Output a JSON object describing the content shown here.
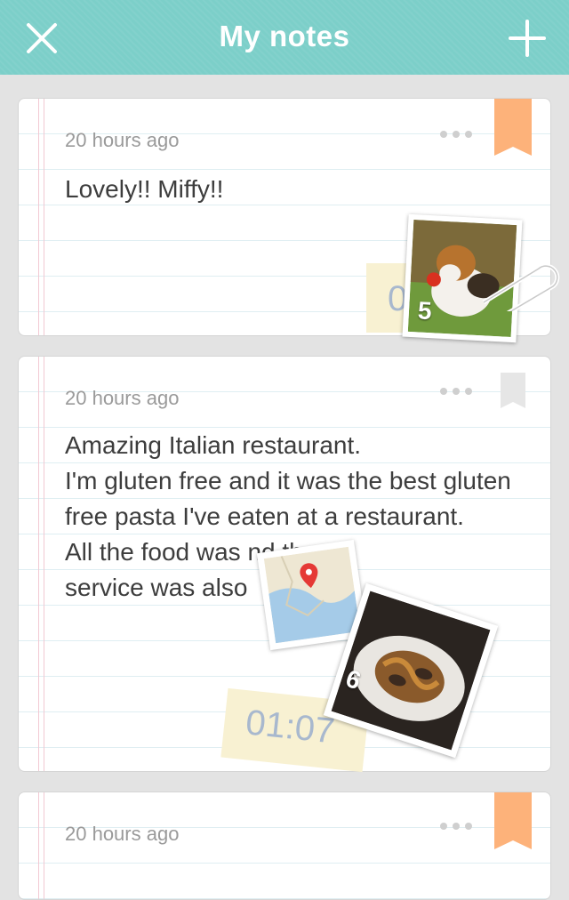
{
  "header": {
    "title": "My notes",
    "close_icon": "close-icon",
    "add_icon": "plus-icon",
    "color": "#7ccfc9"
  },
  "notes": [
    {
      "time": "20 hours ago",
      "text": "Lovely!! Miffy!!",
      "bookmarked": true,
      "photo_count": "5",
      "audio_duration": "0"
    },
    {
      "time": "20 hours ago",
      "text": "Amazing Italian restaurant.\nI'm gluten free and it was the best gluten free pasta I've eaten at a restaurant.\nAll the food was                  nd the\nservice was also",
      "bookmarked": false,
      "photo_count": "6",
      "audio_duration": "01:07"
    },
    {
      "time": "20 hours ago",
      "bookmarked": true
    }
  ],
  "colors": {
    "bookmark_active": "#fdb27a",
    "bookmark_inactive": "#e6e6e6"
  }
}
